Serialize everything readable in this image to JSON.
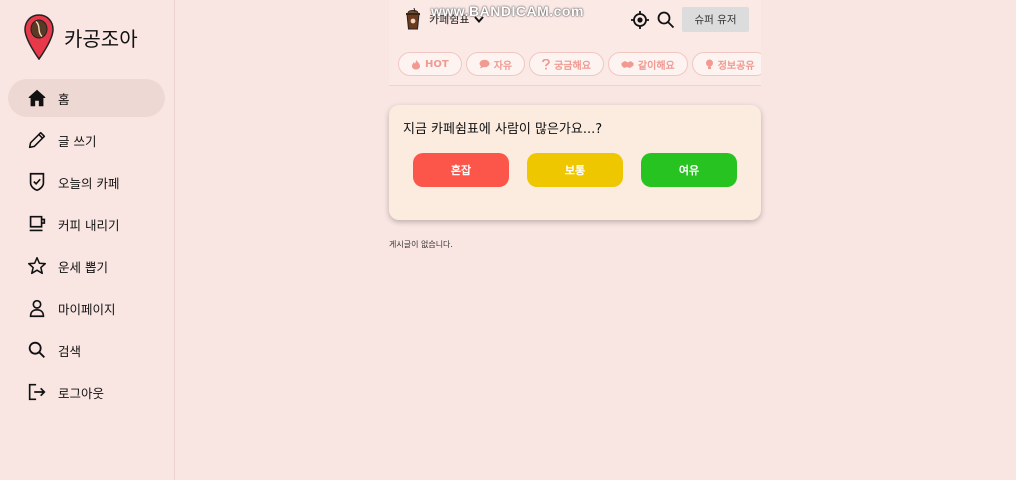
{
  "brand": {
    "name": "카공조아",
    "accent": "#e8394a"
  },
  "sidebar": {
    "items": [
      {
        "label": "홈",
        "icon": "home-icon",
        "active": true
      },
      {
        "label": "글 쓰기",
        "icon": "pencil-icon"
      },
      {
        "label": "오늘의 카페",
        "icon": "shield-check-icon"
      },
      {
        "label": "커피 내리기",
        "icon": "coffee-cup-icon"
      },
      {
        "label": "운세 뽑기",
        "icon": "star-icon"
      },
      {
        "label": "마이페이지",
        "icon": "user-icon"
      },
      {
        "label": "검색",
        "icon": "search-icon"
      },
      {
        "label": "로그아웃",
        "icon": "logout-icon"
      }
    ]
  },
  "header": {
    "cafe_name": "카페쉼표",
    "user_button": "슈퍼 유저",
    "tags": [
      {
        "label": "HOT",
        "icon": "fire-icon"
      },
      {
        "label": "자유",
        "icon": "chat-icon"
      },
      {
        "label": "궁금해요",
        "icon": "question-icon"
      },
      {
        "label": "같이해요",
        "icon": "handshake-icon"
      },
      {
        "label": "정보공유",
        "icon": "bulb-icon"
      }
    ]
  },
  "poll": {
    "question": "지금 카페쉼표에 사람이 많은가요...?",
    "options": [
      {
        "label": "혼잡",
        "color": "#fc5549"
      },
      {
        "label": "보통",
        "color": "#eec700"
      },
      {
        "label": "여유",
        "color": "#27c321"
      }
    ]
  },
  "empty_message": "게시글이 없습니다.",
  "watermark": "www.BANDICAM.com"
}
